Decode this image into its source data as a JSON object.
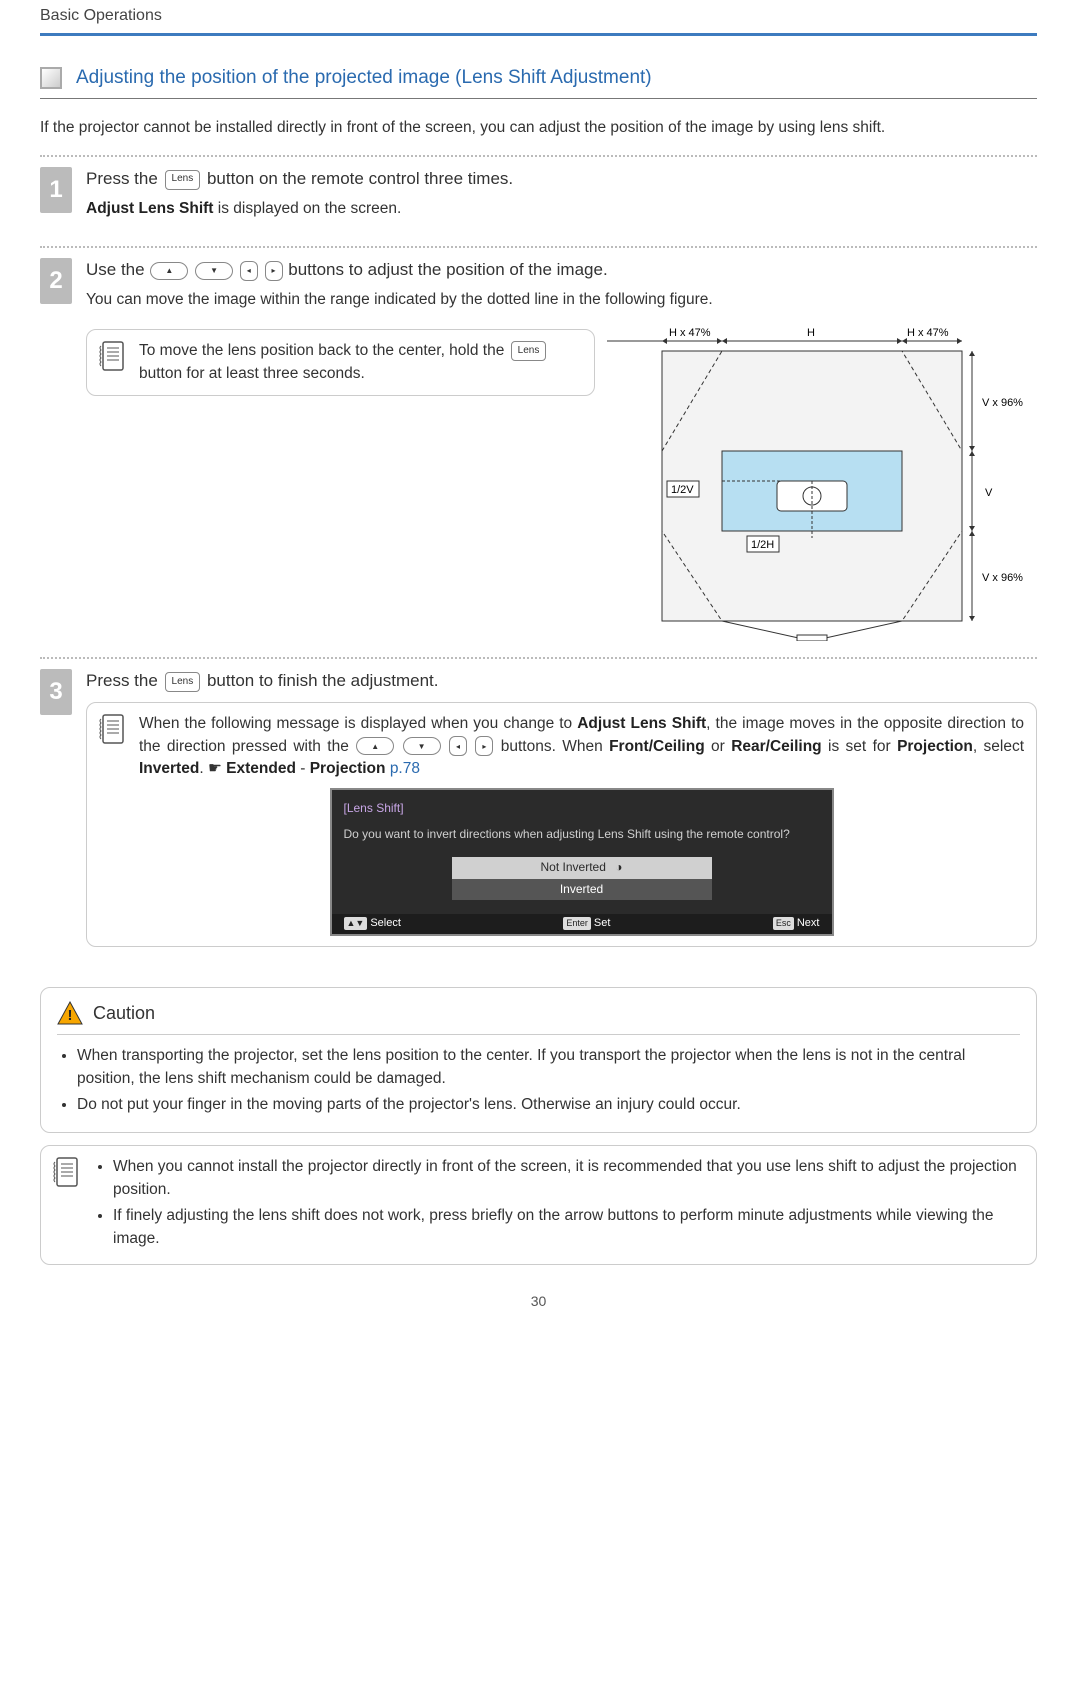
{
  "running_head": "Basic Operations",
  "section_title": "Adjusting the position of the projected image (Lens Shift Adjustment)",
  "intro": "If the projector cannot be installed directly in front of the screen, you can adjust the position of the image by using lens shift.",
  "lens_label": "Lens",
  "arrow_up": "▲",
  "arrow_down": "▼",
  "arrow_left": "◂",
  "arrow_right": "▸",
  "step1": {
    "num": "1",
    "title_a": "Press the ",
    "title_b": " button on the remote control three times.",
    "sub_bold": "Adjust Lens Shift",
    "sub_rest": " is displayed on the screen."
  },
  "step2": {
    "num": "2",
    "title_a": "Use the ",
    "title_b": " buttons to adjust the position of the image.",
    "sub": "You can move the image within the range indicated by the dotted line in the following figure.",
    "note_a": "To move the lens position back to the center, hold the ",
    "note_b": " button for at least three seconds.",
    "fig": {
      "h47_l": "H x 47%",
      "h": "H",
      "h47_r": "H x 47%",
      "v96_t": "V x 96%",
      "v": "V",
      "v96_b": "V x 96%",
      "halfV": "1/2V",
      "halfH": "1/2H"
    }
  },
  "step3": {
    "num": "3",
    "title_a": "Press the ",
    "title_b": " button to finish the adjustment.",
    "note_a": "When the following message is displayed when you change to ",
    "note_bold1": "Adjust Lens Shift",
    "note_b": ", the image moves in the opposite direction to the direction pressed with the ",
    "note_c": " buttons. When ",
    "note_bold2": "Front/Ceiling",
    "note_d": " or ",
    "note_bold3": "Rear/Ceiling",
    "note_e": " is set for ",
    "note_bold4": "Projection",
    "note_f": ", select ",
    "note_bold5": "Inverted",
    "note_g": ". ",
    "pointer": "☛",
    "note_bold6": "Extended",
    "note_h": " - ",
    "note_bold7": "Projection",
    "note_i": "  ",
    "link": "p.78",
    "osd": {
      "title": "[Lens Shift]",
      "q": "Do you want to invert directions when adjusting Lens Shift using the remote control?",
      "opt1": "Not Inverted",
      "opt2": "Inverted",
      "foot_select": "Select",
      "foot_set": "Set",
      "foot_next": "Next",
      "key_updown": "▲▼",
      "key_enter": "Enter",
      "key_esc": "Esc",
      "sel_mark": "◑"
    }
  },
  "caution": {
    "title": "Caution",
    "items": [
      "When transporting the projector, set the lens position to the center. If you transport the projector when the lens is not in the central position, the lens shift mechanism could be damaged.",
      "Do not put your finger in the moving parts of the projector's lens. Otherwise an injury could occur."
    ]
  },
  "tips": {
    "items": [
      "When you cannot install the projector directly in front of the screen, it is recommended that you use lens shift to adjust the projection position.",
      "If finely adjusting the lens shift does not work, press briefly on the arrow buttons to perform minute adjustments while viewing the image."
    ]
  },
  "page_num": "30"
}
